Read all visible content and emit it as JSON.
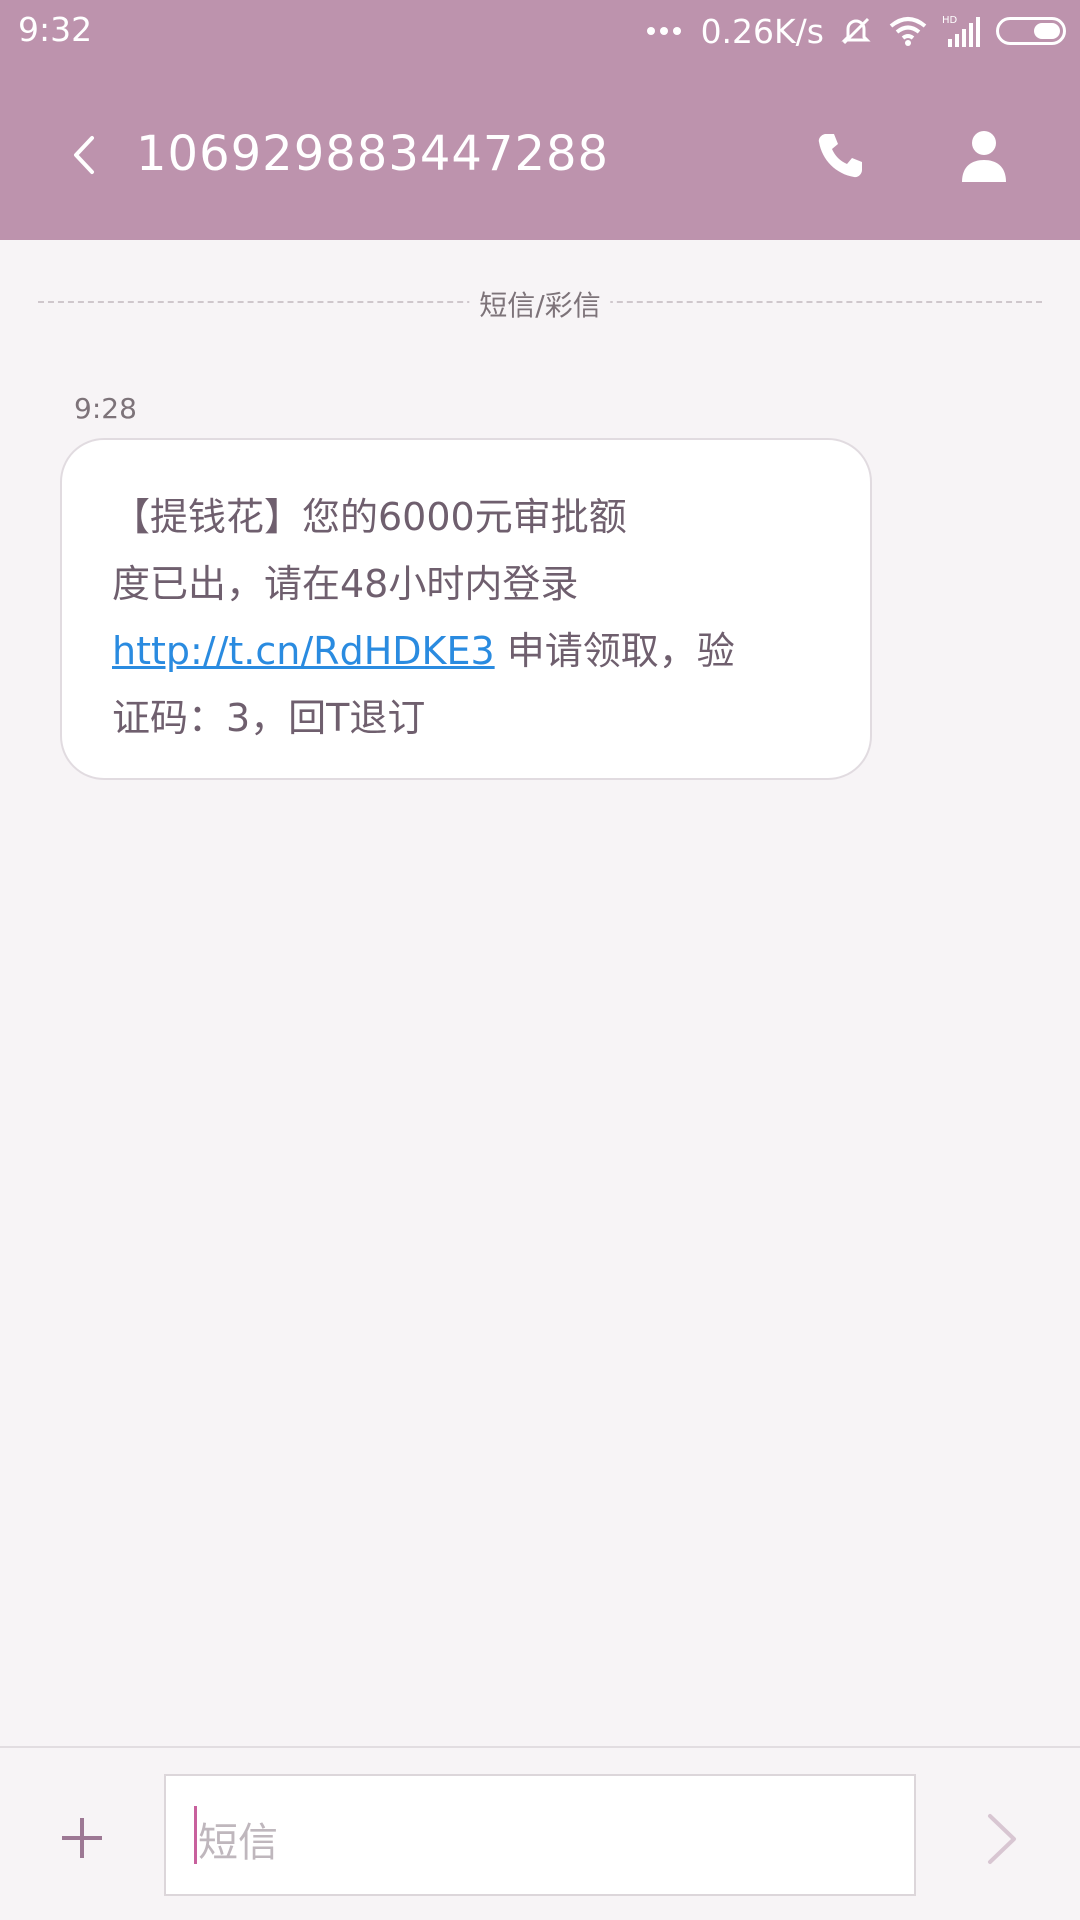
{
  "status_bar": {
    "time": "9:32",
    "net_speed": "0.26K/s",
    "icons": [
      "more-dots-icon",
      "mute-bell-icon",
      "wifi-icon",
      "hd-signal-icon",
      "battery-icon"
    ]
  },
  "header": {
    "title": "106929883447288",
    "back_icon": "chevron-left-icon",
    "call_icon": "phone-icon",
    "contact_icon": "person-icon",
    "color": "#bd93ad"
  },
  "conversation": {
    "divider_label": "短信/彩信",
    "messages": [
      {
        "time": "9:28",
        "text_line1": "【提钱花】您的6000元审批额",
        "text_line2": "度已出，请在48小时内登录",
        "link": "http://t.cn/RdHDKE3",
        "text_after_link": " 申请领取，验",
        "text_line4": "证码：3，回T退订"
      }
    ]
  },
  "composer": {
    "placeholder": "短信",
    "attach_icon": "plus-icon",
    "send_icon": "chevron-right-icon"
  }
}
